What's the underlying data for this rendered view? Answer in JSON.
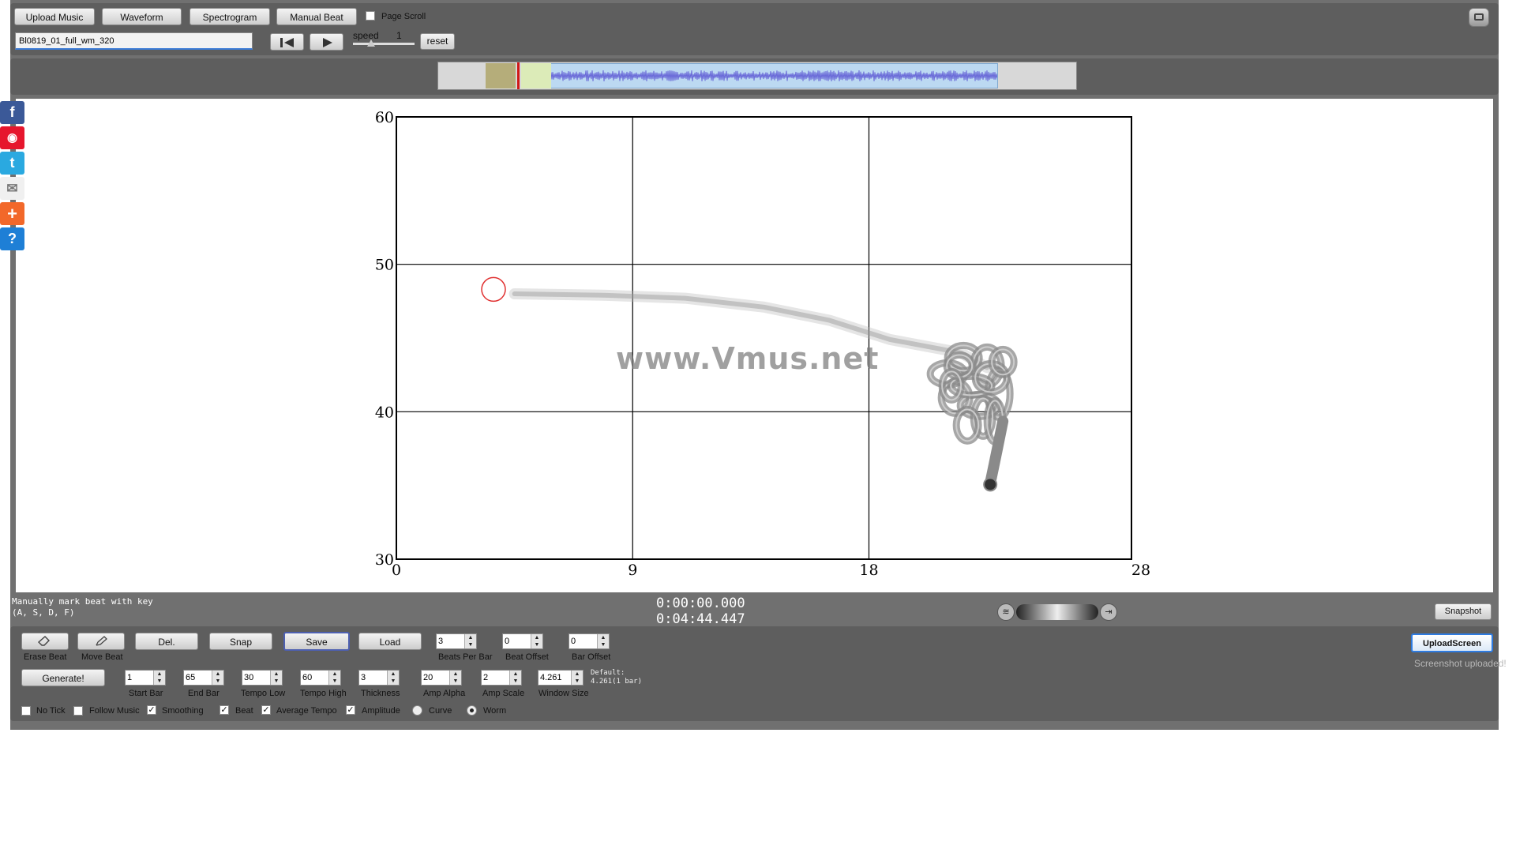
{
  "toolbar": {
    "upload_music": "Upload Music",
    "waveform": "Waveform",
    "spectrogram": "Spectrogram",
    "manual_beat": "Manual Beat",
    "page_scroll": "Page Scroll",
    "filename": "Bl0819_01_full_wm_320",
    "speed_label": "speed",
    "speed_value": "1",
    "reset": "reset"
  },
  "chart": {
    "watermark": "www.Vmus.net",
    "x_ticks": [
      "0",
      "9",
      "18",
      "28"
    ],
    "y_ticks": [
      "60",
      "50",
      "40",
      "30"
    ]
  },
  "chart_data": {
    "type": "line",
    "xlim": [
      0,
      28
    ],
    "ylim": [
      30,
      60
    ],
    "x_ticks": [
      0,
      9,
      18,
      28
    ],
    "y_ticks": [
      30,
      40,
      50,
      60
    ],
    "grid": true,
    "marker": {
      "x": 3.7,
      "y": 48.3
    },
    "trail": [
      {
        "x": 4.5,
        "y": 48.0
      },
      {
        "x": 8,
        "y": 47.9
      },
      {
        "x": 11,
        "y": 47.7
      },
      {
        "x": 14,
        "y": 47.1
      },
      {
        "x": 16.5,
        "y": 46.2
      },
      {
        "x": 18.8,
        "y": 44.9
      },
      {
        "x": 21.5,
        "y": 44.0
      },
      {
        "x": 22.5,
        "y": 43.0
      }
    ]
  },
  "status": {
    "hint_line1": "Manually mark beat with key",
    "hint_line2": "(A, S, D, F)",
    "time_current": "0:00:00.000",
    "time_total": "0:04:44.447",
    "snapshot": "Snapshot",
    "upload_screen": "UploadScreen",
    "uploaded_msg": "Screenshot uploaded!"
  },
  "controls": {
    "erase_beat": "Erase Beat",
    "move_beat": "Move Beat",
    "del": "Del.",
    "snap": "Snap",
    "save": "Save",
    "load": "Load",
    "generate": "Generate!",
    "beats_per_bar": {
      "label": "Beats Per Bar",
      "value": "3"
    },
    "beat_offset": {
      "label": "Beat Offset",
      "value": "0"
    },
    "bar_offset": {
      "label": "Bar Offset",
      "value": "0"
    },
    "start_bar": {
      "label": "Start Bar",
      "value": "1"
    },
    "end_bar": {
      "label": "End Bar",
      "value": "65"
    },
    "tempo_low": {
      "label": "Tempo Low",
      "value": "30"
    },
    "tempo_high": {
      "label": "Tempo High",
      "value": "60"
    },
    "thickness": {
      "label": "Thickness",
      "value": "3"
    },
    "amp_alpha": {
      "label": "Amp Alpha",
      "value": "20"
    },
    "amp_scale": {
      "label": "Amp Scale",
      "value": "2"
    },
    "window_size": {
      "label": "Window Size",
      "value": "4.261"
    },
    "default_line1": "Default:",
    "default_line2": "4.261(1 bar)",
    "no_tick": "No Tick",
    "follow_music": "Follow Music",
    "smoothing": "Smoothing",
    "beat": "Beat",
    "average_tempo": "Average Tempo",
    "amplitude": "Amplitude",
    "curve": "Curve",
    "worm": "Worm"
  }
}
